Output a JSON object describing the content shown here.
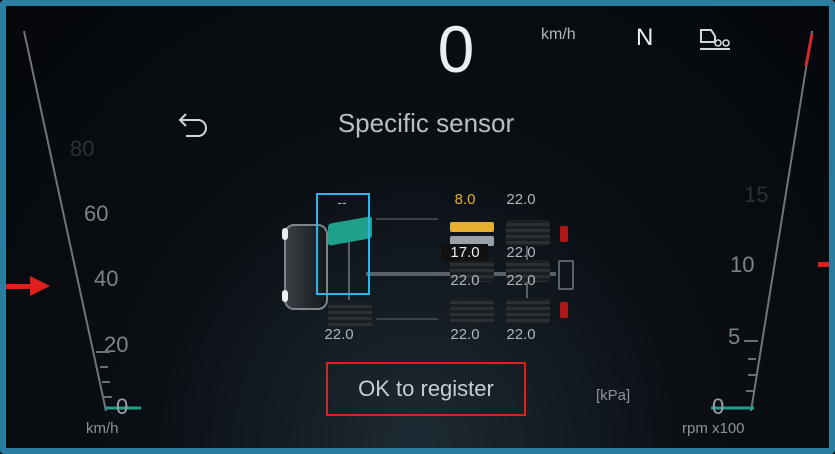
{
  "header": {
    "speed": "0",
    "speed_unit": "km/h",
    "gear": "N",
    "trailer_icon": "truck-trailer-icon"
  },
  "screen": {
    "title": "Specific sensor",
    "back_icon": "back-arrow-icon",
    "ok_button": "OK to register",
    "pressure_unit": "[kPa]"
  },
  "left_gauge": {
    "labels": [
      "80",
      "60",
      "40",
      "20",
      "0"
    ],
    "unit": "km/h"
  },
  "right_gauge": {
    "labels": [
      "15",
      "10",
      "5",
      "0"
    ],
    "unit": "rpm x100"
  },
  "tyres": {
    "selected_value": "--",
    "front_left": "22.0",
    "row1_left": "8.0",
    "row1_right": "22.0",
    "row2_left": "17.0",
    "row2_right": "22.0",
    "row3_left": "22.0",
    "row3_right": "22.0",
    "row4_left": "22.0",
    "row4_right": "22.0"
  },
  "colors": {
    "accent": "#2bb5e8",
    "warning": "#e8b030",
    "highlight_box": "#e01e1e",
    "selected_tyre": "#1ea08a",
    "frame": "#2a7ea0"
  }
}
